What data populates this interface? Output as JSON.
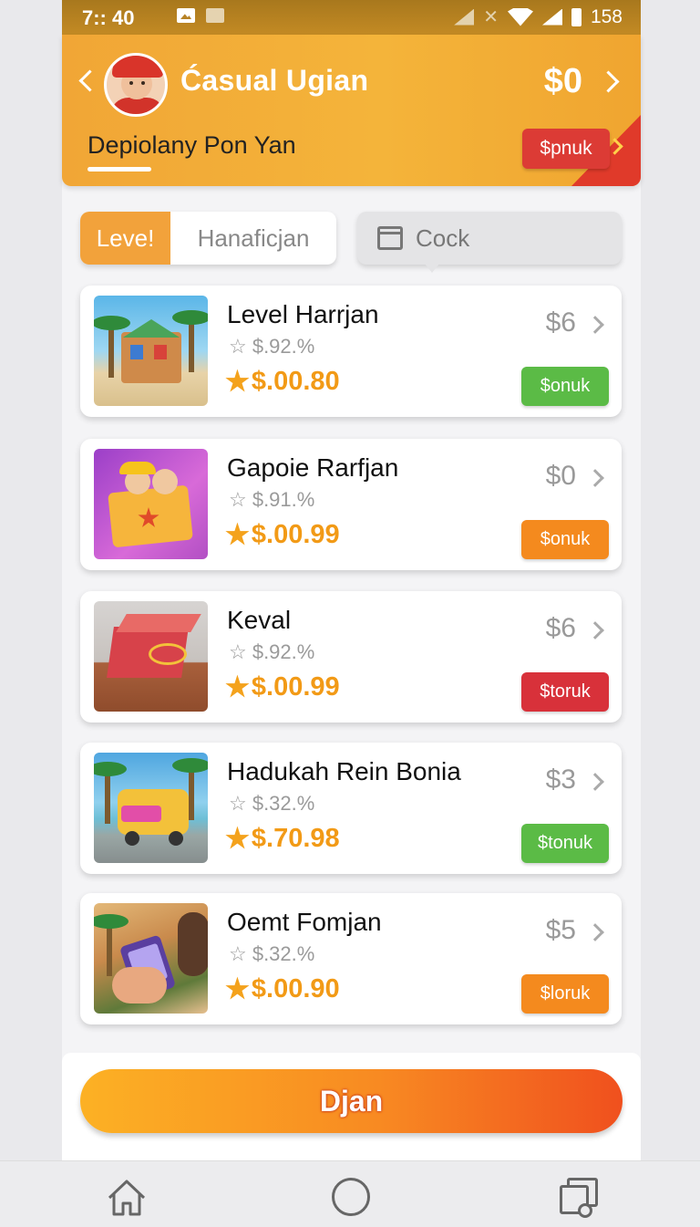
{
  "status_bar": {
    "time": "7:: 40",
    "battery": "158"
  },
  "header": {
    "app_title": "Ćasual Ugian",
    "balance": "$0",
    "subtitle": "Depiolany Pon  Yan",
    "bonus_label": "$pnuk"
  },
  "tabs": {
    "active_label": "Leve!",
    "inactive_label": "Hanaficjan",
    "cock_label": "Cock"
  },
  "items": [
    {
      "title": "Level Harrjan",
      "rating": "☆ $.92.%",
      "price": "$.00.80",
      "value": "$6",
      "button": "$onuk",
      "button_color": "#5bbb46"
    },
    {
      "title": "Gapoie Rarfjan",
      "rating": "☆ $.91.%",
      "price": "$.00.99",
      "value": "$0",
      "button": "$onuk",
      "button_color": "#f48a1e"
    },
    {
      "title": "Keval",
      "rating": "☆ $.92.%",
      "price": "$.00.99",
      "value": "$6",
      "button": "$toruk",
      "button_color": "#d8313a"
    },
    {
      "title": "Hadukah Rein Bonia",
      "rating": "☆ $.32.%",
      "price": "$.70.98",
      "value": "$3",
      "button": "$tonuk",
      "button_color": "#5bbb46"
    },
    {
      "title": "Oemt Fomjan",
      "rating": "☆ $.32.%",
      "price": "$.00.90",
      "value": "$5",
      "button": "$loruk",
      "button_color": "#f48a1e"
    }
  ],
  "cta": {
    "label": "Djan"
  },
  "colors": {
    "header_orange": "#f4b43a",
    "accent_red": "#dc3b35",
    "price_orange": "#f29a16"
  },
  "icons": [
    "back-chevron-icon",
    "forward-chevron-icon",
    "star-icon",
    "box-icon",
    "home-icon",
    "circle-home-icon",
    "recent-apps-icon"
  ]
}
